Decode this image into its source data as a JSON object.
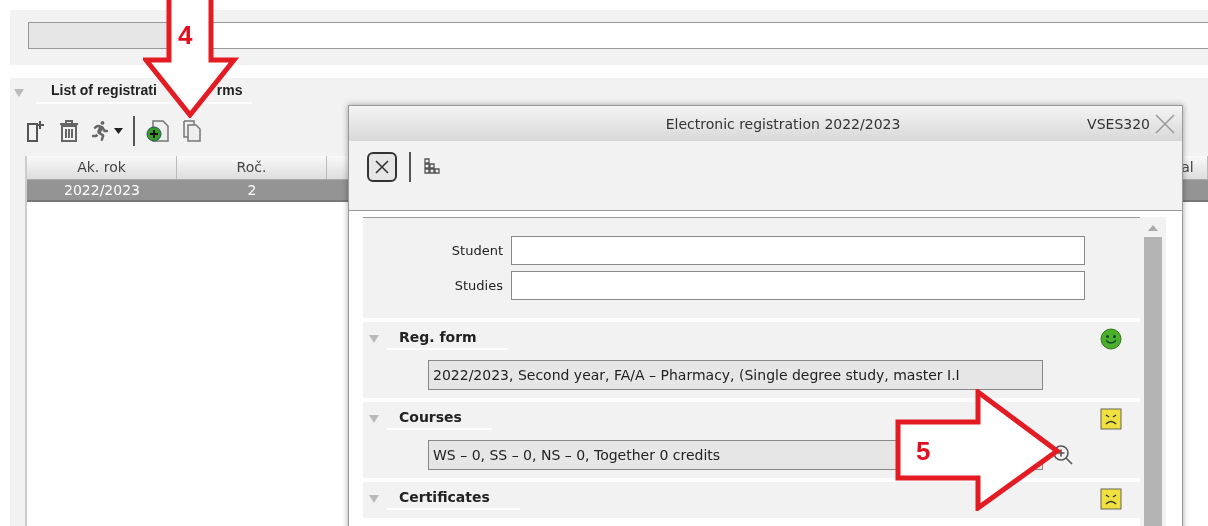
{
  "top_panel": {
    "field": {
      "kind": "field"
    }
  },
  "list_panel": {
    "title_parts": [
      "List of registrati",
      "rms"
    ],
    "expanded": true,
    "toolbar": [
      {
        "kind": "new"
      },
      {
        "kind": "delete"
      },
      {
        "kind": "run"
      },
      {
        "kind": "separator"
      },
      {
        "kind": "add"
      },
      {
        "kind": "copy"
      }
    ],
    "table": {
      "columns": [
        "Ak. rok",
        "Roč.",
        "al"
      ],
      "rows": [
        {
          "cells": [
            "2022/2023",
            "2"
          ],
          "selected": true
        }
      ]
    }
  },
  "dialog": {
    "title": "Electronic registration 2022/2023",
    "code": "VSES320",
    "toolbar": [
      {
        "kind": "close"
      },
      {
        "kind": "separator"
      },
      {
        "kind": "tree"
      }
    ],
    "fields": [
      {
        "label": "Student"
      },
      {
        "label": "Studies"
      }
    ],
    "sections": [
      {
        "title": "Reg. form",
        "expanded": true,
        "happy": true,
        "value": "2022/2023, Second year, FA/A – Pharmacy, (Single degree study, master I.I"
      },
      {
        "title": "Courses",
        "expanded": true,
        "happy": false,
        "value": "WS – 0, SS – 0, NS – 0, Together 0 credits",
        "zoomable": true
      },
      {
        "title": "Certificates",
        "expanded": true,
        "happy": false
      }
    ]
  },
  "annotations": [
    {
      "kind": "down",
      "label": "4"
    },
    {
      "kind": "right",
      "label": "5"
    }
  ]
}
